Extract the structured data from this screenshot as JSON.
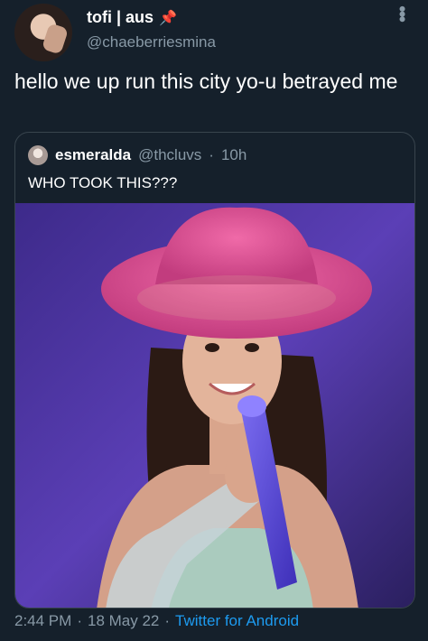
{
  "author": {
    "display_name": "tofi | aus",
    "handle": "@chaeberriesmina",
    "badge_icon": "pushpin-icon"
  },
  "tweet": {
    "text": "hello we up run this city yo-u betrayed me"
  },
  "quoted_tweet": {
    "display_name": "esmeralda",
    "handle": "@thcluvs",
    "separator": "·",
    "age": "10h",
    "text": "WHO TOOK THIS???"
  },
  "footer": {
    "time": "2:44 PM",
    "dot1": "·",
    "date": "18 May 22",
    "dot2": "·",
    "source": "Twitter for Android"
  },
  "colors": {
    "background": "#15202b",
    "secondary_text": "#8899a6",
    "link": "#1d9bf0",
    "border": "#38444d"
  }
}
